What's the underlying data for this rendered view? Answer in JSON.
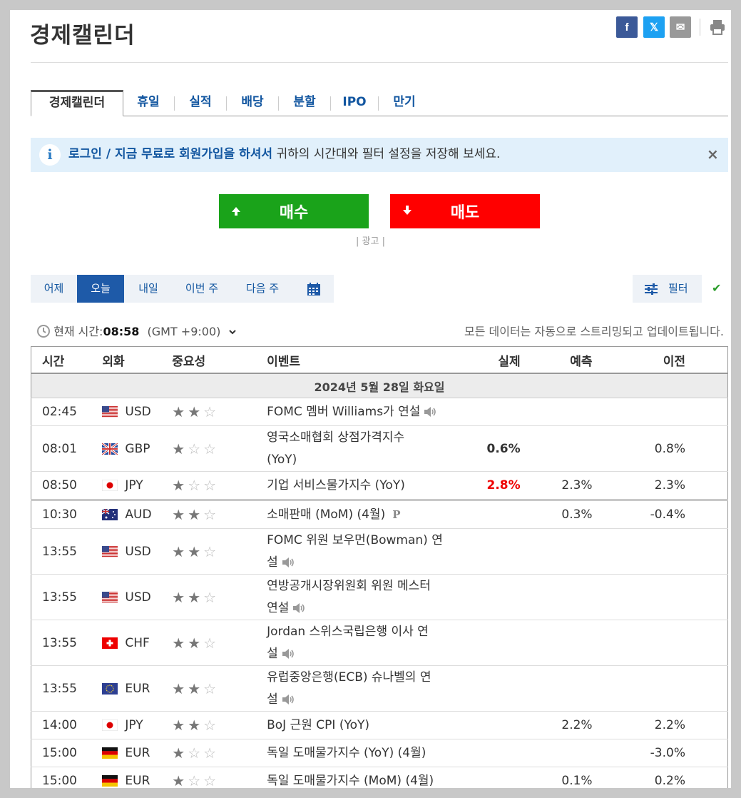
{
  "page": {
    "title": "경제캘린더"
  },
  "share": {
    "facebook": "f",
    "x": "𝕏",
    "email": "✉"
  },
  "tabs": [
    {
      "label": "경제캘린더",
      "active": true
    },
    {
      "label": "휴일"
    },
    {
      "label": "실적"
    },
    {
      "label": "배당"
    },
    {
      "label": "분할"
    },
    {
      "label": "IPO"
    },
    {
      "label": "만기"
    }
  ],
  "banner": {
    "login": "로그인",
    "slash": " / ",
    "signup": "지금 무료로 회원가입을 하셔서",
    "rest": " 귀하의 시간대와 필터 설정을 저장해 보세요.",
    "close": "×"
  },
  "trade": {
    "buy": "매수",
    "sell": "매도",
    "ad": "| 광고 |",
    "buy_color": "#1aa31a",
    "sell_color": "#ff0000"
  },
  "days": {
    "yesterday": "어제",
    "today": "오늘",
    "tomorrow": "내일",
    "this_week": "이번 주",
    "next_week": "다음 주"
  },
  "filter": {
    "label": "필터"
  },
  "clock": {
    "label": "현재 시간:",
    "time": "08:58",
    "tz": "(GMT +9:00)"
  },
  "stream": "모든 데이터는 자동으로 스트리밍되고 업데이트됩니다.",
  "table": {
    "headers": {
      "time": "시간",
      "currency": "외화",
      "importance": "중요성",
      "event": "이벤트",
      "actual": "실제",
      "forecast": "예측",
      "previous": "이전"
    },
    "date": "2024년 5월 28일 화요일",
    "rows": [
      {
        "time": "02:45",
        "flag": "us",
        "cur": "USD",
        "imp": 2,
        "ev1": "FOMC 멤버 Williams가 연설",
        "ev2": "",
        "speech": true,
        "actual": "",
        "forecast": "",
        "previous": ""
      },
      {
        "time": "08:01",
        "flag": "gb",
        "cur": "GBP",
        "imp": 1,
        "ev1": "영국소매협회 상점가격지수",
        "ev2": "(YoY)",
        "speech": false,
        "actual": "0.6%",
        "actual_style": "bold",
        "forecast": "",
        "previous": "0.8%"
      },
      {
        "time": "08:50",
        "flag": "jp",
        "cur": "JPY",
        "imp": 1,
        "ev1": "기업 서비스물가지수 (YoY)",
        "ev2": "",
        "speech": false,
        "actual": "2.8%",
        "actual_style": "red",
        "forecast": "2.3%",
        "previous": "2.3%",
        "thick": true
      },
      {
        "time": "10:30",
        "flag": "au",
        "cur": "AUD",
        "imp": 2,
        "ev1": "소매판매 (MoM) (4월)",
        "ev2": "",
        "speech": false,
        "prelim": "P",
        "actual": "",
        "forecast": "0.3%",
        "previous": "-0.4%"
      },
      {
        "time": "13:55",
        "flag": "us",
        "cur": "USD",
        "imp": 2,
        "ev1": "FOMC 위원 보우먼(Bowman) 연",
        "ev2": "설",
        "speech": true,
        "actual": "",
        "forecast": "",
        "previous": ""
      },
      {
        "time": "13:55",
        "flag": "us",
        "cur": "USD",
        "imp": 2,
        "ev1": "연방공개시장위원회 위원 메스터",
        "ev2": "연설",
        "speech": true,
        "actual": "",
        "forecast": "",
        "previous": ""
      },
      {
        "time": "13:55",
        "flag": "ch",
        "cur": "CHF",
        "imp": 2,
        "ev1": "Jordan 스위스국립은행 이사 연",
        "ev2": "설",
        "speech": true,
        "actual": "",
        "forecast": "",
        "previous": ""
      },
      {
        "time": "13:55",
        "flag": "eu",
        "cur": "EUR",
        "imp": 2,
        "ev1": "유럽중앙은행(ECB) 슈나벨의 연",
        "ev2": "설",
        "speech": true,
        "actual": "",
        "forecast": "",
        "previous": ""
      },
      {
        "time": "14:00",
        "flag": "jp",
        "cur": "JPY",
        "imp": 2,
        "ev1": "BoJ 근원 CPI (YoY)",
        "ev2": "",
        "speech": false,
        "actual": "",
        "forecast": "2.2%",
        "previous": "2.2%"
      },
      {
        "time": "15:00",
        "flag": "de",
        "cur": "EUR",
        "imp": 1,
        "ev1": "독일 도매물가지수 (YoY) (4월)",
        "ev2": "",
        "speech": false,
        "actual": "",
        "forecast": "",
        "previous": "-3.0%"
      },
      {
        "time": "15:00",
        "flag": "de",
        "cur": "EUR",
        "imp": 1,
        "ev1": "독일 도매물가지수 (MoM) (4월)",
        "ev2": "",
        "speech": false,
        "actual": "",
        "forecast": "0.1%",
        "previous": "0.2%"
      }
    ]
  }
}
